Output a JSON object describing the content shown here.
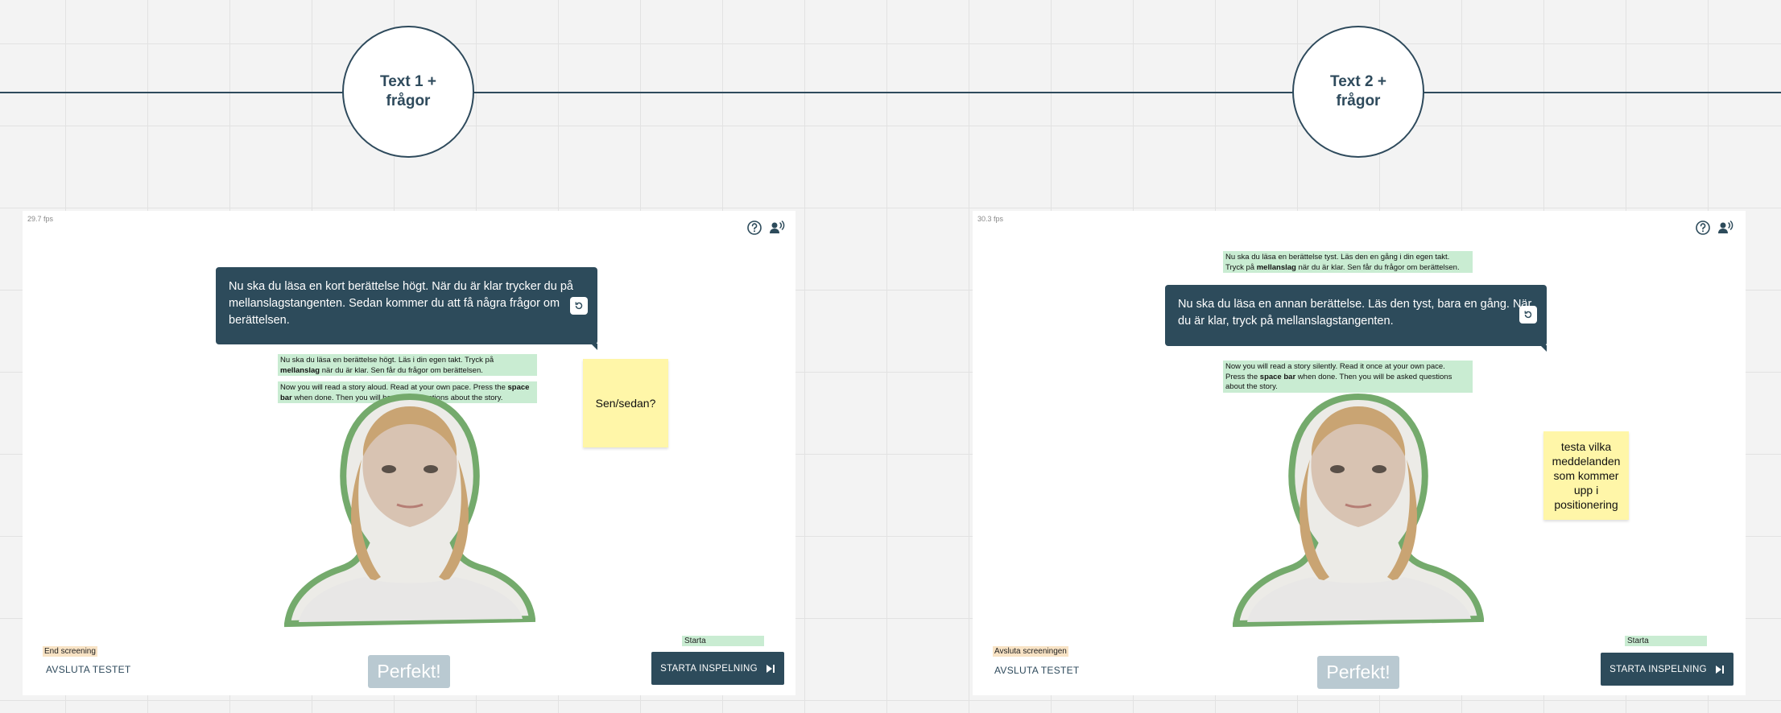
{
  "timeline": {
    "step1_label": "Text 1 + frågor",
    "step2_label": "Text 2 + frågor"
  },
  "panel1": {
    "fps": "29.7 fps",
    "instruction": "Nu ska du läsa en kort berättelse högt. När du är klar trycker du på mellanslagstangenten. Sedan kommer du att få några frågor om berättelsen.",
    "note_sv_pre": "Nu ska du läsa en berättelse högt. Läs i din egen takt. Tryck på",
    "note_sv_bold": "mellanslag",
    "note_sv_post": "när du är klar. Sen får du frågor om berättelsen.",
    "note_en_pre": "Now you will read a story aloud. Read at your own pace. Press the",
    "note_en_bold": "space bar",
    "note_en_post": "when done. Then you will be asked questions about the story.",
    "sticky": "Sen/sedan?",
    "end_tag": "End screening",
    "exit_label": "AVSLUTA TESTET",
    "feedback": "Perfekt!",
    "start_tag": "Starta",
    "start_button": "STARTA INSPELNING"
  },
  "panel2": {
    "fps": "30.3 fps",
    "note_top_line1": "Nu ska du läsa en berättelse tyst. Läs den en gång i din egen takt.",
    "note_top_pre": "Tryck på",
    "note_top_bold": "mellanslag",
    "note_top_post": "när du är klar. Sen får du frågor om berättelsen.",
    "instruction": "Nu ska du läsa en annan berättelse. Läs den tyst, bara en gång. När du är klar, tryck på mellanslagstangenten.",
    "note_en_line1": "Now you will read a story silently. Read it once at your own pace.",
    "note_en_pre": "Press the",
    "note_en_bold": "space bar",
    "note_en_post": "when done. Then you will be asked questions about the story.",
    "sticky": "testa vilka meddelanden som kommer upp i positionering",
    "end_tag": "Avsluta screeningen",
    "exit_label": "AVSLUTA TESTET",
    "feedback": "Perfekt!",
    "start_tag": "Starta",
    "start_button": "STARTA INSPELNING"
  },
  "icons": {
    "help": "help-circle-icon",
    "voice": "voice-speaker-icon",
    "replay": "replay-icon",
    "skip": "skip-next-icon"
  },
  "colors": {
    "dark": "#2d4b5b",
    "note_green": "#c9ecd2",
    "sticky_yellow": "#fff6a8",
    "tag_orange": "#f8e3c5",
    "avatar_outline": "#74aa6c",
    "feedback_bg": "#b9c9d1"
  }
}
